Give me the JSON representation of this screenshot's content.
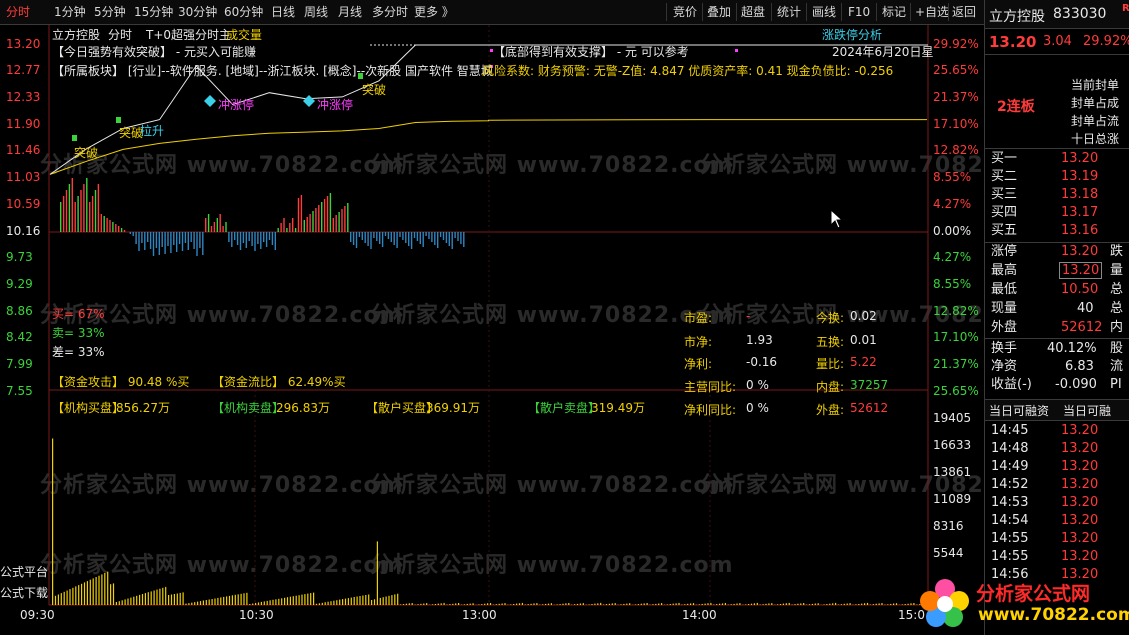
{
  "toolbar": {
    "left_tabs": [
      "分时",
      "1分钟",
      "5分钟",
      "15分钟",
      "30分钟",
      "60分钟",
      "日线",
      "周线",
      "月线",
      "多分时",
      "更多 》"
    ],
    "right_tabs": [
      "竞价",
      "叠加",
      "超盘",
      "统计",
      "画线",
      "F10",
      "标记",
      "+自选",
      "返回"
    ]
  },
  "chart_header": {
    "name": "立方控股",
    "mode": "分时",
    "indicator": "T+0超强分时主",
    "volume_label": "成交量",
    "analysis_link": "涨跌停分析",
    "date": "2024年6月20日星"
  },
  "signals": {
    "line1_left": "【今日强势有效突破】 - 元买入可能赚",
    "line1_right": "【底部得到有效支撑】 - 元 可以参考",
    "line2": "【所属板块】 [行业]--软件服务. [地域]--浙江板块. [概念]--次新股 国产软件 智慧城",
    "risk": "风险系数: 财务预警: 无警-Z值: 4.847 优质资产率: 0.41 现金负债比: -0.256",
    "tags": [
      "突破",
      "突破",
      "拉升",
      "冲涨停",
      "冲涨停",
      "突破"
    ]
  },
  "y_axis_left": [
    "13.20",
    "12.77",
    "12.33",
    "11.90",
    "11.46",
    "11.03",
    "10.59",
    "10.16",
    "9.73",
    "9.29",
    "8.86",
    "8.42",
    "7.99",
    "7.55"
  ],
  "y_axis_right": [
    "29.92%",
    "25.65%",
    "21.37%",
    "17.10%",
    "12.82%",
    "8.55%",
    "4.27%",
    "0.00%",
    "4.27%",
    "8.55%",
    "12.82%",
    "17.10%",
    "21.37%",
    "25.65%"
  ],
  "vol_axis": [
    "19405",
    "16633",
    "13861",
    "11089",
    "8316",
    "5544"
  ],
  "x_axis": [
    "09:30",
    "10:30",
    "13:00",
    "14:00",
    "15:0"
  ],
  "sentiment": {
    "buy": "买= 67%",
    "sell": "卖= 33%",
    "diff": "差= 33%"
  },
  "funds": {
    "attack": "【资金攻击】 90.48 %买",
    "flow": "【资金流比】 62.49%买",
    "inst_buy_label": "【机构买盘】",
    "inst_buy": "856.27万",
    "inst_sell_label": "【机构卖盘】",
    "inst_sell": "296.83万",
    "retail_buy_label": "【散户买盘】",
    "retail_buy": "369.91万",
    "retail_sell_label": "【散户卖盘】",
    "retail_sell": "319.49万"
  },
  "fundamentals": [
    {
      "k": "市盈:",
      "v": "-",
      "k2": "今换:",
      "v2": "0.02"
    },
    {
      "k": "市净:",
      "v": "1.93",
      "k2": "五换:",
      "v2": "0.01"
    },
    {
      "k": "净利:",
      "v": "-0.16",
      "k2": "量比:",
      "v2": "5.22"
    },
    {
      "k": "主营同比:",
      "v": "0 %",
      "k2": "内盘:",
      "v2": "37257"
    },
    {
      "k": "净利同比:",
      "v": "0 %",
      "k2": "外盘:",
      "v2": "52612"
    }
  ],
  "left_edge_labels": [
    "公式平台",
    "公式下载"
  ],
  "watermark": "分析家公式网 www.70822.com",
  "logo": {
    "title": "分析家公式网",
    "url": "www.70822.com"
  },
  "side": {
    "name": "立方控股",
    "code": "833030",
    "r_badge": "R",
    "price": "13.20",
    "change": "3.04",
    "pct": "29.92%",
    "board": "2连板",
    "seal_lines": [
      "当前封单",
      "封单占成",
      "封单占流",
      "十日总涨"
    ],
    "bids": [
      {
        "label": "买一",
        "price": "13.20"
      },
      {
        "label": "买二",
        "price": "13.19"
      },
      {
        "label": "买三",
        "price": "13.18"
      },
      {
        "label": "买四",
        "price": "13.17"
      },
      {
        "label": "买五",
        "price": "13.16"
      }
    ],
    "stats1": [
      {
        "k": "涨停",
        "v": "13.20",
        "k2": "跌"
      },
      {
        "k": "最高",
        "v": "13.20",
        "k2": "量"
      },
      {
        "k": "最低",
        "v": "10.50",
        "k2": "总"
      },
      {
        "k": "现量",
        "v": "40",
        "k2": "总"
      },
      {
        "k": "外盘",
        "v": "52612",
        "k2": "内"
      }
    ],
    "stats2": [
      {
        "k": "换手",
        "v": "40.12%",
        "k2": "股"
      },
      {
        "k": "净资",
        "v": "6.83",
        "k2": "流"
      },
      {
        "k": "收益(-)",
        "v": "-0.090",
        "k2": "PI"
      }
    ],
    "margin_tabs": [
      "当日可融资",
      "当日可融"
    ],
    "ticks": [
      {
        "t": "14:45",
        "p": "13.20"
      },
      {
        "t": "14:48",
        "p": "13.20"
      },
      {
        "t": "14:49",
        "p": "13.20"
      },
      {
        "t": "14:52",
        "p": "13.20"
      },
      {
        "t": "14:53",
        "p": "13.20"
      },
      {
        "t": "14:54",
        "p": "13.20"
      },
      {
        "t": "14:55",
        "p": "13.20"
      },
      {
        "t": "14:55",
        "p": "13.20"
      },
      {
        "t": "14:56",
        "p": "13.20"
      }
    ]
  },
  "chart_data": {
    "type": "line",
    "title": "",
    "xlabel": "",
    "ylabel": "",
    "x": [
      "09:30",
      "09:40",
      "09:50",
      "10:00",
      "10:10",
      "10:20",
      "10:30",
      "10:40",
      "10:50",
      "11:00",
      "11:10",
      "11:20",
      "11:30",
      "13:00",
      "14:00",
      "15:00"
    ],
    "series": [
      {
        "values": [
          11.03,
          11.46,
          11.8,
          11.95,
          12.85,
          12.2,
          12.4,
          12.3,
          12.33,
          12.6,
          13.2,
          13.2,
          13.2,
          13.2,
          13.2,
          13.2
        ]
      },
      {
        "values": [
          11.03,
          11.25,
          11.45,
          11.55,
          11.62,
          11.68,
          11.72,
          11.74,
          11.76,
          11.8,
          11.9,
          11.92,
          11.93,
          11.94,
          11.95,
          11.95
        ]
      }
    ],
    "ylim": [
      7.55,
      13.2
    ],
    "volume_ylim": [
      0,
      19405
    ]
  }
}
